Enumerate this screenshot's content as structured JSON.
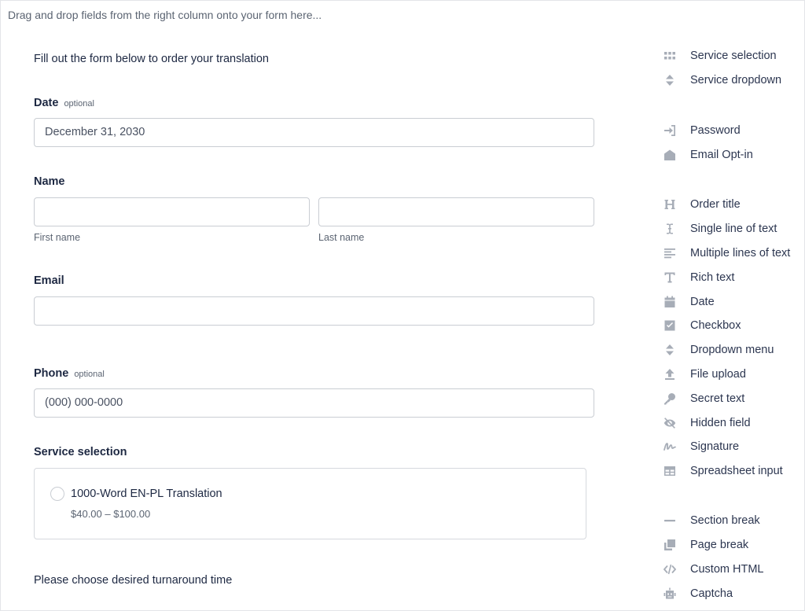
{
  "hint": "Drag and drop fields from the right column onto your form here...",
  "form": {
    "intro": "Fill out the form below to order your translation",
    "date": {
      "label": "Date",
      "optional": "optional",
      "value": "December 31, 2030"
    },
    "name": {
      "label": "Name",
      "first_label": "First name",
      "last_label": "Last name",
      "first_value": "",
      "last_value": ""
    },
    "email": {
      "label": "Email",
      "value": ""
    },
    "phone": {
      "label": "Phone",
      "optional": "optional",
      "value": "(000) 000-0000"
    },
    "service": {
      "label": "Service selection",
      "option_name": "1000-Word EN-PL Translation",
      "option_price": "$40.00 – $100.00"
    },
    "turnaround": "Please choose desired turnaround time"
  },
  "palette": {
    "items": [
      {
        "label": "Service selection",
        "icon": "grid-icon"
      },
      {
        "label": "Service dropdown",
        "icon": "sort-icon"
      },
      {
        "label": "Password",
        "icon": "login-icon"
      },
      {
        "label": "Email Opt-in",
        "icon": "envelope-open-icon"
      },
      {
        "label": "Order title",
        "icon": "heading-icon"
      },
      {
        "label": "Single line of text",
        "icon": "text-cursor-icon"
      },
      {
        "label": "Multiple lines of text",
        "icon": "align-left-icon"
      },
      {
        "label": "Rich text",
        "icon": "text-icon"
      },
      {
        "label": "Date",
        "icon": "calendar-icon"
      },
      {
        "label": "Checkbox",
        "icon": "checkbox-icon"
      },
      {
        "label": "Dropdown menu",
        "icon": "sort-icon"
      },
      {
        "label": "File upload",
        "icon": "upload-icon"
      },
      {
        "label": "Secret text",
        "icon": "key-icon"
      },
      {
        "label": "Hidden field",
        "icon": "eye-slash-icon"
      },
      {
        "label": "Signature",
        "icon": "signature-icon"
      },
      {
        "label": "Spreadsheet input",
        "icon": "table-icon"
      },
      {
        "label": "Section break",
        "icon": "minus-icon"
      },
      {
        "label": "Page break",
        "icon": "copy-icon"
      },
      {
        "label": "Custom HTML",
        "icon": "code-icon"
      },
      {
        "label": "Captcha",
        "icon": "robot-icon"
      }
    ]
  }
}
